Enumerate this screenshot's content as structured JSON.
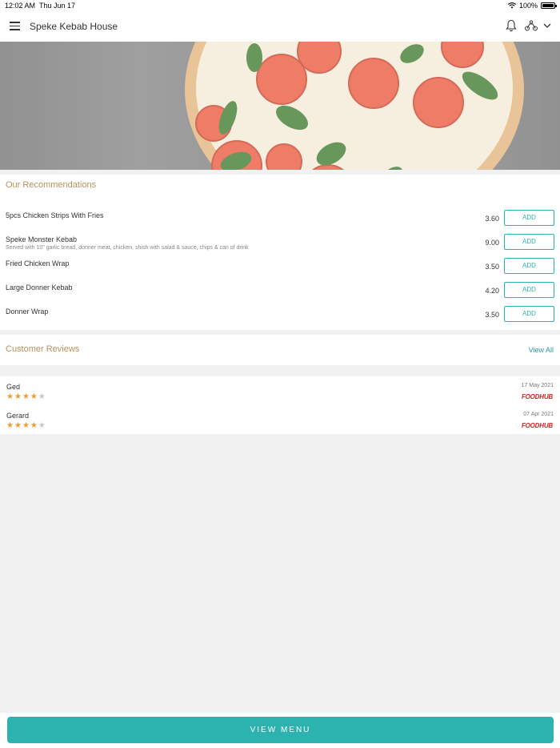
{
  "status_bar": {
    "time": "12:02 AM",
    "day": "Thu Jun 17",
    "battery": "100%"
  },
  "header": {
    "title": "Speke Kebab House"
  },
  "recommendations": {
    "title": "Our Recommendations",
    "items": [
      {
        "name": "5pcs Chicken Strips With Fries",
        "description": "",
        "price": "3.60",
        "add_label": "ADD"
      },
      {
        "name": "Speke Monster Kebab",
        "description": "Served with 10\" garlic bread, donner meat, chicken, shish with salad & sauce, chips & can of drink",
        "price": "9.00",
        "add_label": "ADD"
      },
      {
        "name": "Fried Chicken Wrap",
        "description": "",
        "price": "3.50",
        "add_label": "ADD"
      },
      {
        "name": "Large Donner Kebab",
        "description": "",
        "price": "4.20",
        "add_label": "ADD"
      },
      {
        "name": "Donner Wrap",
        "description": "",
        "price": "3.50",
        "add_label": "ADD"
      }
    ]
  },
  "reviews": {
    "title": "Customer Reviews",
    "view_all": "View All",
    "items": [
      {
        "name": "Ged",
        "rating": 4,
        "max_rating": 5,
        "date": "17 May 2021",
        "source": "FOODHUB"
      },
      {
        "name": "Gerard",
        "rating": 4,
        "max_rating": 5,
        "date": "07 Apr 2021",
        "source": "FOODHUB"
      }
    ]
  },
  "bottom": {
    "view_menu": "VIEW MENU"
  },
  "colors": {
    "accent": "#2cb3b0",
    "section_title": "#b7925c",
    "star": "#f29a2e",
    "brand_red": "#d42222"
  }
}
